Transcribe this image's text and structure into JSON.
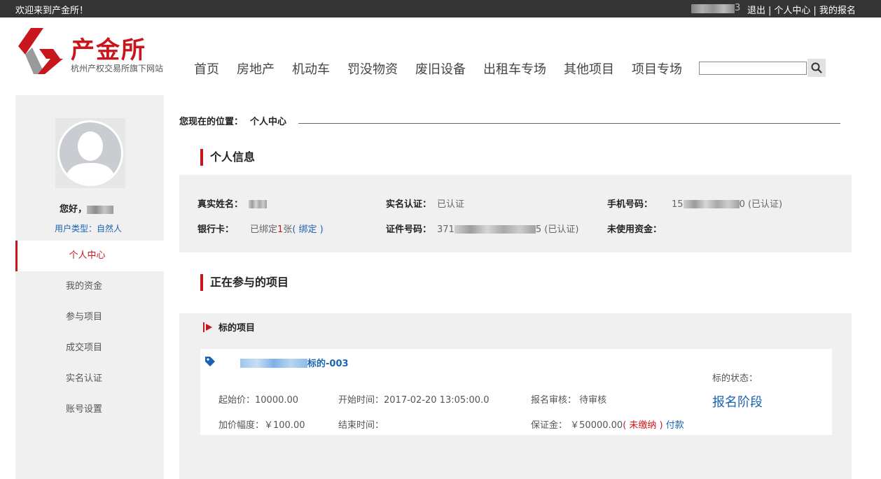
{
  "topbar": {
    "welcome": "欢迎来到产金所！",
    "user_suffix": "3",
    "logout": "退出",
    "center": "个人中心",
    "my_signup": "我的报名"
  },
  "header": {
    "brand": "产金所",
    "subtitle": "杭州产权交易所旗下网站",
    "nav": [
      "首页",
      "房地产",
      "机动车",
      "罚没物资",
      "废旧设备",
      "出租车专场",
      "其他项目",
      "项目专场"
    ],
    "search_placeholder": ""
  },
  "sidebar": {
    "greeting": "您好，",
    "user_type_label": "用户类型：",
    "user_type_value": "自然人",
    "menu": [
      "个人中心",
      "我的资金",
      "参与项目",
      "成交项目",
      "实名认证",
      "账号设置"
    ]
  },
  "breadcrumb": {
    "label": "您现在的位置：",
    "current": "个人中心"
  },
  "personal_info": {
    "title": "个人信息",
    "real_name_label": "真实姓名：",
    "real_name_verify_label": "实名认证：",
    "real_name_verify_value": "已认证",
    "phone_label": "手机号码：",
    "phone_prefix": "15",
    "phone_suffix": "0",
    "phone_status": "(已认证)",
    "bank_label": "银行卡：",
    "bank_value_pre": "已绑定",
    "bank_count": "1",
    "bank_value_post": "张",
    "bank_bind": "( 绑定 )",
    "id_label": "证件号码：",
    "id_prefix": "371",
    "id_suffix": "5",
    "id_status": "(已认证)",
    "unused_funds_label": "未使用资金："
  },
  "projects": {
    "title": "正在参与的项目",
    "subject_header": "标的项目",
    "item": {
      "name_suffix": "标的-003",
      "start_price": "起始价：10000.00",
      "start_time": "开始时间：2017-02-20 13:05:00.0",
      "review_label": "报名审核：",
      "review_value": "待审核",
      "increment": "加价幅度：￥100.00",
      "end_time": "结束时间：",
      "deposit_label": "保证金：",
      "deposit_value": "￥50000.00",
      "deposit_status": "( 未缴纳 )",
      "pay": "付款",
      "status_label": "标的状态：",
      "status_value": "报名阶段"
    }
  }
}
